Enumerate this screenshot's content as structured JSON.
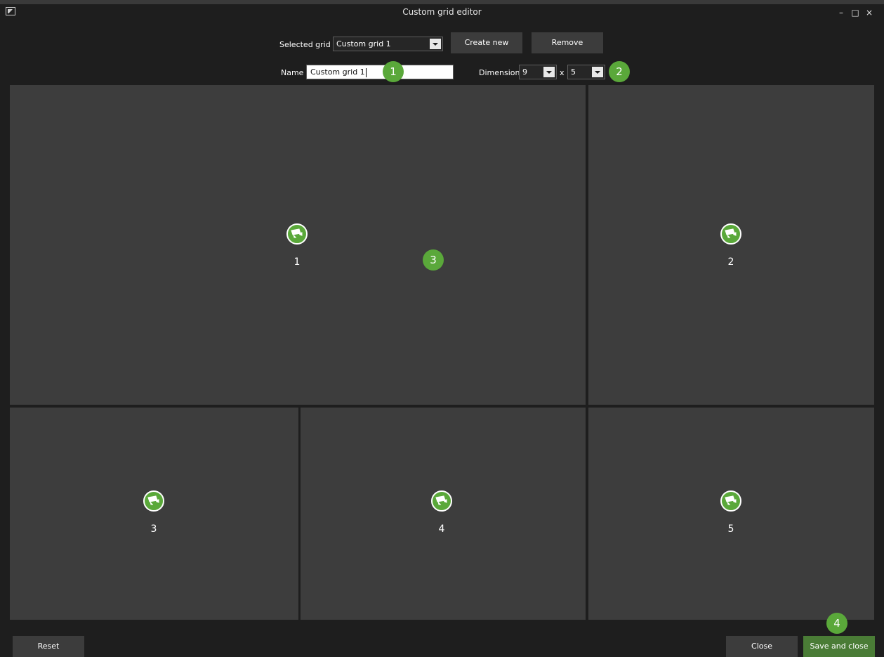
{
  "window": {
    "title": "Custom grid editor",
    "minimize": "–",
    "maximize": "□",
    "close": "×"
  },
  "toolbar": {
    "selected_grid_label": "Selected grid",
    "selected_grid_value": "Custom grid 1",
    "create_new_label": "Create new",
    "remove_label": "Remove",
    "name_label": "Name",
    "name_value": "Custom grid 1",
    "dimensions_label": "Dimensions",
    "dim_cols": "9",
    "dim_sep": "x",
    "dim_rows": "5"
  },
  "badges": [
    "1",
    "2",
    "3",
    "4"
  ],
  "cells": [
    {
      "number": "1",
      "icon": "camera-icon"
    },
    {
      "number": "2",
      "icon": "camera-icon"
    },
    {
      "number": "3",
      "icon": "camera-icon"
    },
    {
      "number": "4",
      "icon": "camera-icon"
    },
    {
      "number": "5",
      "icon": "camera-icon"
    }
  ],
  "footer": {
    "reset_label": "Reset",
    "close_label": "Close",
    "save_close_label": "Save and close"
  },
  "colors": {
    "accent_green": "#5aa83a",
    "save_button": "#4a7c36",
    "cell_background": "#3d3d3d",
    "window_background": "#1e1e1e"
  }
}
